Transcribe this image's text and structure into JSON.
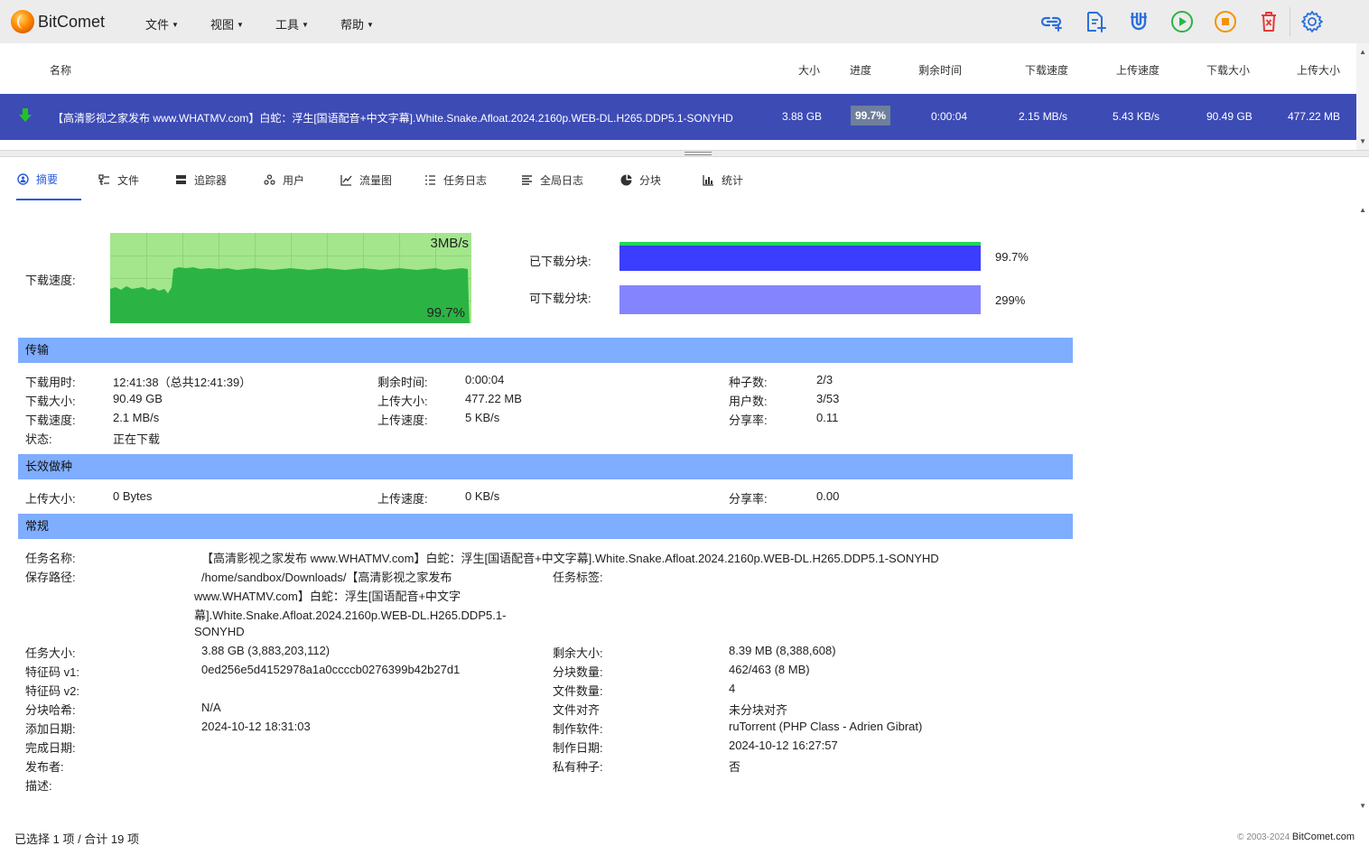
{
  "app": {
    "title": "BitComet"
  },
  "menu": [
    {
      "label": "文件"
    },
    {
      "label": "视图"
    },
    {
      "label": "工具"
    },
    {
      "label": "帮助"
    }
  ],
  "colors": {
    "accent": "#2a5bd7",
    "selected_row": "#3d4bb5",
    "section_header": "#7fadff",
    "graph_bg": "#a3e68c",
    "graph_fill": "#2bb444",
    "bar_downloaded": "#3b3dff",
    "bar_available": "#8484ff"
  },
  "columns": {
    "name": "名称",
    "size": "大小",
    "progress": "进度",
    "remaining": "剩余时间",
    "down_speed": "下载速度",
    "up_speed": "上传速度",
    "downloaded": "下载大小",
    "uploaded": "上传大小"
  },
  "task": {
    "name": "【高清影视之家发布 www.WHATMV.com】白蛇：浮生[国语配音+中文字幕].White.Snake.Afloat.2024.2160p.WEB-DL.H265.DDP5.1-SONYHD",
    "size": "3.88 GB",
    "progress": "99.7%",
    "remaining": "0:00:04",
    "down_speed": "2.15 MB/s",
    "up_speed": "5.43 KB/s",
    "downloaded": "90.49 GB",
    "uploaded": "477.22 MB"
  },
  "tabs": [
    {
      "label": "摘要",
      "icon": "info-icon"
    },
    {
      "label": "文件",
      "icon": "files-icon"
    },
    {
      "label": "追踪器",
      "icon": "server-icon"
    },
    {
      "label": "用户",
      "icon": "users-icon"
    },
    {
      "label": "流量图",
      "icon": "chart-icon"
    },
    {
      "label": "任务日志",
      "icon": "list-icon"
    },
    {
      "label": "全局日志",
      "icon": "log-icon"
    },
    {
      "label": "分块",
      "icon": "pie-icon"
    },
    {
      "label": "统计",
      "icon": "bar-chart-icon"
    }
  ],
  "summary": {
    "speed_label": "下载速度:",
    "graph_max": "3MB/s",
    "graph_progress": "99.7%",
    "downloaded_pieces_label": "已下载分块:",
    "downloaded_pieces_value": "99.7%",
    "available_pieces_label": "可下载分块:",
    "available_pieces_value": "299%"
  },
  "transfer": {
    "title": "传输",
    "dl_time_label": "下载用时:",
    "dl_time": "12:41:38（总共12:41:39）",
    "dl_size_label": "下载大小:",
    "dl_size": "90.49 GB",
    "dl_speed_label": "下载速度:",
    "dl_speed": "2.1 MB/s",
    "state_label": "状态:",
    "state": "正在下载",
    "remaining_label": "剩余时间:",
    "remaining": "0:00:04",
    "up_size_label": "上传大小:",
    "up_size": "477.22 MB",
    "up_speed_label": "上传速度:",
    "up_speed": "5 KB/s",
    "seeds_label": "种子数:",
    "seeds": "2/3",
    "peers_label": "用户数:",
    "peers": "3/53",
    "ratio_label": "分享率:",
    "ratio": "0.11"
  },
  "seeding": {
    "title": "长效做种",
    "up_size_label": "上传大小:",
    "up_size": "0 Bytes",
    "up_speed_label": "上传速度:",
    "up_speed": "0 KB/s",
    "ratio_label": "分享率:",
    "ratio": "0.00"
  },
  "general": {
    "title": "常规",
    "task_name_label": "任务名称:",
    "task_name": "【高清影视之家发布 www.WHATMV.com】白蛇：浮生[国语配音+中文字幕].White.Snake.Afloat.2024.2160p.WEB-DL.H265.DDP5.1-SONYHD",
    "save_path_label": "保存路径:",
    "save_path_1": "/home/sandbox/Downloads/【高清影视之家发布",
    "save_path_2": "www.WHATMV.com】白蛇：浮生[国语配音+中文字",
    "save_path_3": "幕].White.Snake.Afloat.2024.2160p.WEB-DL.H265.DDP5.1-",
    "save_path_4": "SONYHD",
    "tag_label": "任务标签:",
    "task_size_label": "任务大小:",
    "task_size": "3.88 GB (3,883,203,112)",
    "hash_v1_label": "特征码 v1:",
    "hash_v1": "0ed256e5d4152978a1a0ccccb0276399b42b27d1",
    "hash_v2_label": "特征码 v2:",
    "piece_hash_label": "分块哈希:",
    "piece_hash": "N/A",
    "added_label": "添加日期:",
    "added": "2024-10-12 18:31:03",
    "completed_label": "完成日期:",
    "publisher_label": "发布者:",
    "desc_label": "描述:",
    "left_size_label": "剩余大小:",
    "left_size": "8.39 MB (8,388,608)",
    "pieces_label": "分块数量:",
    "pieces": "462/463 (8 MB)",
    "files_label": "文件数量:",
    "files": "4",
    "align_label": "文件对齐",
    "align": "未分块对齐",
    "creator_label": "制作软件:",
    "creator": "ruTorrent (PHP Class - Adrien Gibrat)",
    "created_label": "制作日期:",
    "created": "2024-10-12 16:27:57",
    "private_label": "私有种子:",
    "private": "否"
  },
  "status": {
    "selection": "已选择 1 项 / 合计 19 项",
    "copyright": "© 2003-2024",
    "brand": "BitComet.com"
  }
}
